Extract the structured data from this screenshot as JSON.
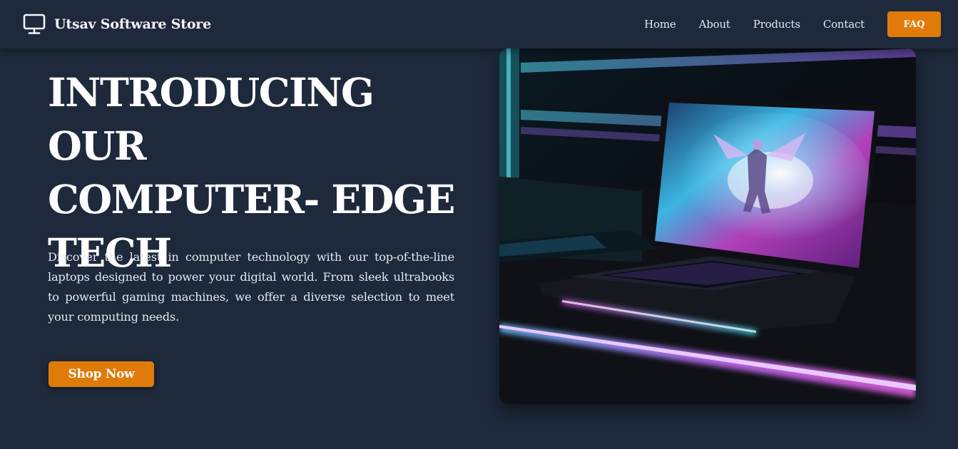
{
  "brand": {
    "name": "Utsav Software Store",
    "icon": "monitor-icon"
  },
  "nav": {
    "links": [
      "Home",
      "About",
      "Products",
      "Contact"
    ],
    "faq_label": "FAQ"
  },
  "hero": {
    "title_lines": [
      "INTRODUCING OUR",
      "COMPUTER- EDGE",
      "TECH"
    ],
    "description": "Discover the latest in computer technology with our top-of-the-line laptops designed to power your digital world. From sleek ultrabooks to powerful gaming machines, we offer a diverse selection to meet your computing needs.",
    "cta_label": "Shop Now",
    "image": "laptop-product-image"
  },
  "colors": {
    "background": "#1e293b",
    "accent": "#e07b0a",
    "text": "#ffffff"
  }
}
